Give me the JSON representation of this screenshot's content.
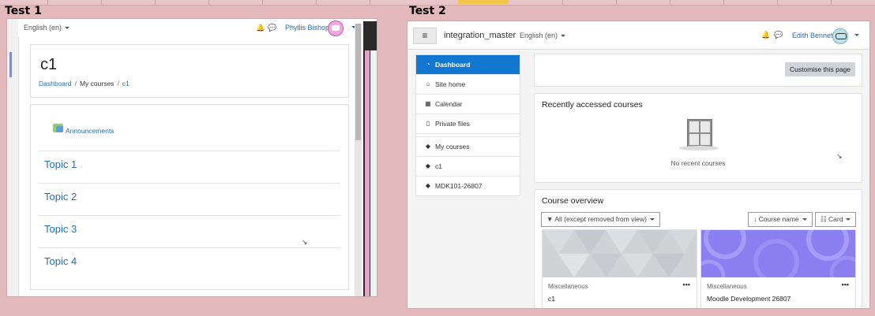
{
  "labels": {
    "test1": "Test 1",
    "test2": "Test 2"
  },
  "test1": {
    "language": "English (en)",
    "user_name": "Phyllis Bishop",
    "course_title": "c1",
    "breadcrumb": [
      "Dashboard",
      "My courses",
      "c1"
    ],
    "announcements": "Announcements",
    "topics": [
      "Topic 1",
      "Topic 2",
      "Topic 3",
      "Topic 4"
    ]
  },
  "test2": {
    "site_name": "integration_master",
    "language": "English (en)",
    "user_name": "Edith Bennett",
    "nav": [
      {
        "label": "Dashboard",
        "icon": "dashboard-icon",
        "active": true
      },
      {
        "label": "Site home",
        "icon": "home-icon"
      },
      {
        "label": "Calendar",
        "icon": "calendar-icon"
      },
      {
        "label": "Private files",
        "icon": "file-icon"
      },
      {
        "label": "My courses",
        "icon": "graduation-cap-icon"
      },
      {
        "label": "c1",
        "icon": "graduation-cap-icon"
      },
      {
        "label": "MDK101-26807",
        "icon": "graduation-cap-icon"
      }
    ],
    "customise_button": "Customise this page",
    "recent_title": "Recently accessed courses",
    "no_recent": "No recent courses",
    "overview_title": "Course overview",
    "filter_label": "All (except removed from view)",
    "sort_label": "Course name",
    "view_label": "Card",
    "courses": [
      {
        "category": "Miscellaneous",
        "name": "c1",
        "color": "#cfd3d6"
      },
      {
        "category": "Miscellaneous",
        "name": "Moodle Development 26807",
        "color": "#8b7ef0"
      }
    ]
  },
  "colors": {
    "accent": "#1177d1",
    "link": "#1f6fb5",
    "backdrop": "#e3b9bb"
  }
}
